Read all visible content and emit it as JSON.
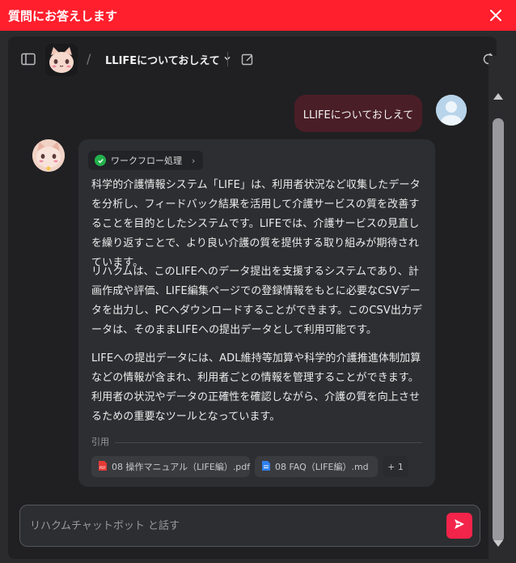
{
  "titlebar": {
    "title": "質問にお答えします",
    "close_icon": "close-icon"
  },
  "header": {
    "bot_name": "LLIFEについておしえて",
    "slash": "/",
    "icons": [
      "sidebar-toggle-icon",
      "chevron-down-icon",
      "edit-icon",
      "refresh-icon"
    ]
  },
  "user_message": {
    "text": "LLIFEについておしえて"
  },
  "answer": {
    "workflow_label": "ワークフロー処理",
    "paragraphs": [
      "科学的介護情報システム「LIFE」は、利用者状況など収集したデータを分析し、フィードバック結果を活用して介護サービスの質を改善することを目的としたシステムです。LIFEでは、介護サービスの見直しを繰り返すことで、より良い介護の質を提供する取り組みが期待されています。",
      "リハクムは、このLIFEへのデータ提出を支援するシステムであり、計画作成や評価、LIFE編集ページでの登録情報をもとに必要なCSVデータを出力し、PCへダウンロードすることができます。このCSV出力データは、そのままLIFEへの提出データとして利用可能です。",
      "LIFEへの提出データには、ADL維持等加算や科学的介護推進体制加算などの情報が含まれ、利用者ごとの情報を管理することができます。利用者の状況やデータの正確性を確認しながら、介護の質を向上させるための重要なツールとなっています。"
    ],
    "citations_label": "引用",
    "citations": [
      {
        "name": "08 操作マニュアル（LIFE編）.pdf",
        "icon": "pdf-file-icon"
      },
      {
        "name": "08 FAQ（LIFE編）.md",
        "icon": "doc-file-icon"
      }
    ],
    "more_citations": "+ 1"
  },
  "composer": {
    "placeholder": "リハクムチャットボット と話す",
    "send_icon": "send-icon"
  },
  "colors": {
    "titlebar": "#ff1f2d",
    "send": "#f3244a",
    "user_bubble": "#4a1e27",
    "check": "#22b14c"
  }
}
